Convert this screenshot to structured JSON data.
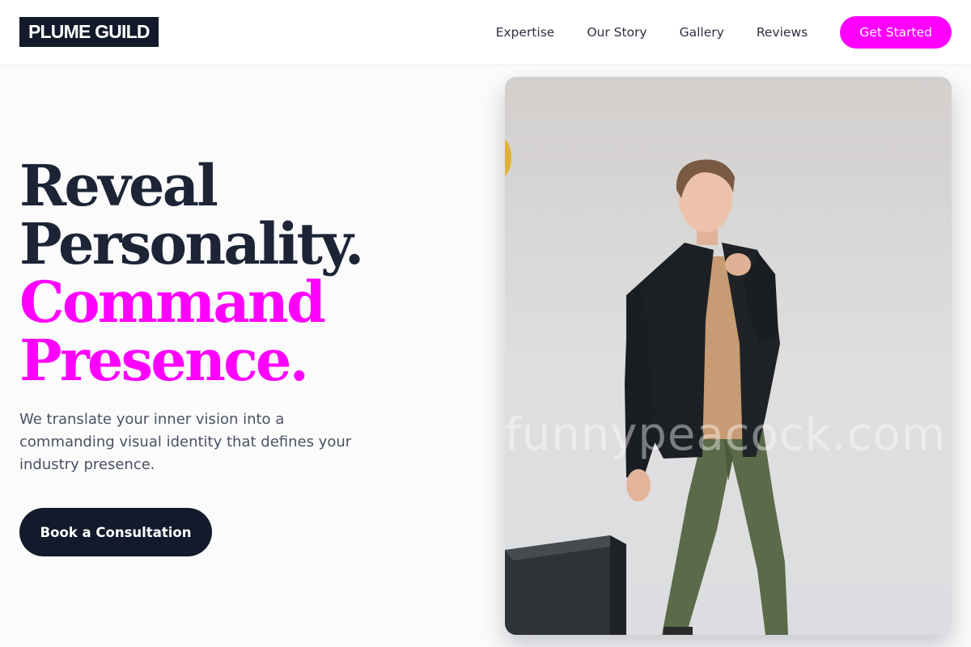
{
  "brand": {
    "name": "PLUME GUILD"
  },
  "nav": {
    "links": [
      "Expertise",
      "Our Story",
      "Gallery",
      "Reviews"
    ],
    "cta_label": "Get Started"
  },
  "hero": {
    "title_line1": "Reveal",
    "title_line2": "Personality.",
    "title_line3": "Command",
    "title_line4": "Presence.",
    "description": "We translate your inner vision into a commanding visual identity that defines your industry presence.",
    "button_label": "Book a Consultation"
  },
  "photo": {
    "watermark": "funnypeacock.com"
  },
  "colors": {
    "accent": "#ff00ff",
    "dark": "#121a2b",
    "text_muted": "#4a5263"
  }
}
